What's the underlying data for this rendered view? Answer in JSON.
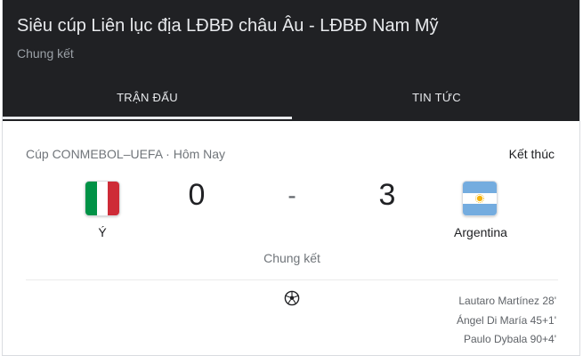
{
  "header": {
    "title": "Siêu cúp Liên lục địa LĐBĐ châu Âu - LĐBĐ Nam Mỹ",
    "subtitle": "Chung kết",
    "tabs": [
      {
        "label": "TRẬN ĐẤU",
        "active": true
      },
      {
        "label": "TIN TỨC",
        "active": false
      }
    ]
  },
  "match": {
    "league": "Cúp CONMEBOL–UEFA · Hôm Nay",
    "status": "Kết thúc",
    "home": {
      "name": "Ý",
      "score": "0",
      "flag_icon": "italy-flag-icon"
    },
    "away": {
      "name": "Argentina",
      "score": "3",
      "flag_icon": "argentina-flag-icon"
    },
    "separator": "-",
    "stage": "Chung kết",
    "goal_icon": "soccer-ball-icon",
    "away_scorers": [
      "Lautaro Martínez 28'",
      "Ángel Di María 45+1'",
      "Paulo Dybala 90+4'"
    ]
  },
  "colors": {
    "header_bg": "#202124",
    "header_text": "#e8eaed",
    "muted_text": "#70757a",
    "italy": [
      "#009246",
      "#ffffff",
      "#ce2b37"
    ],
    "argentina": [
      "#74acdf",
      "#ffffff",
      "#74acdf"
    ]
  }
}
